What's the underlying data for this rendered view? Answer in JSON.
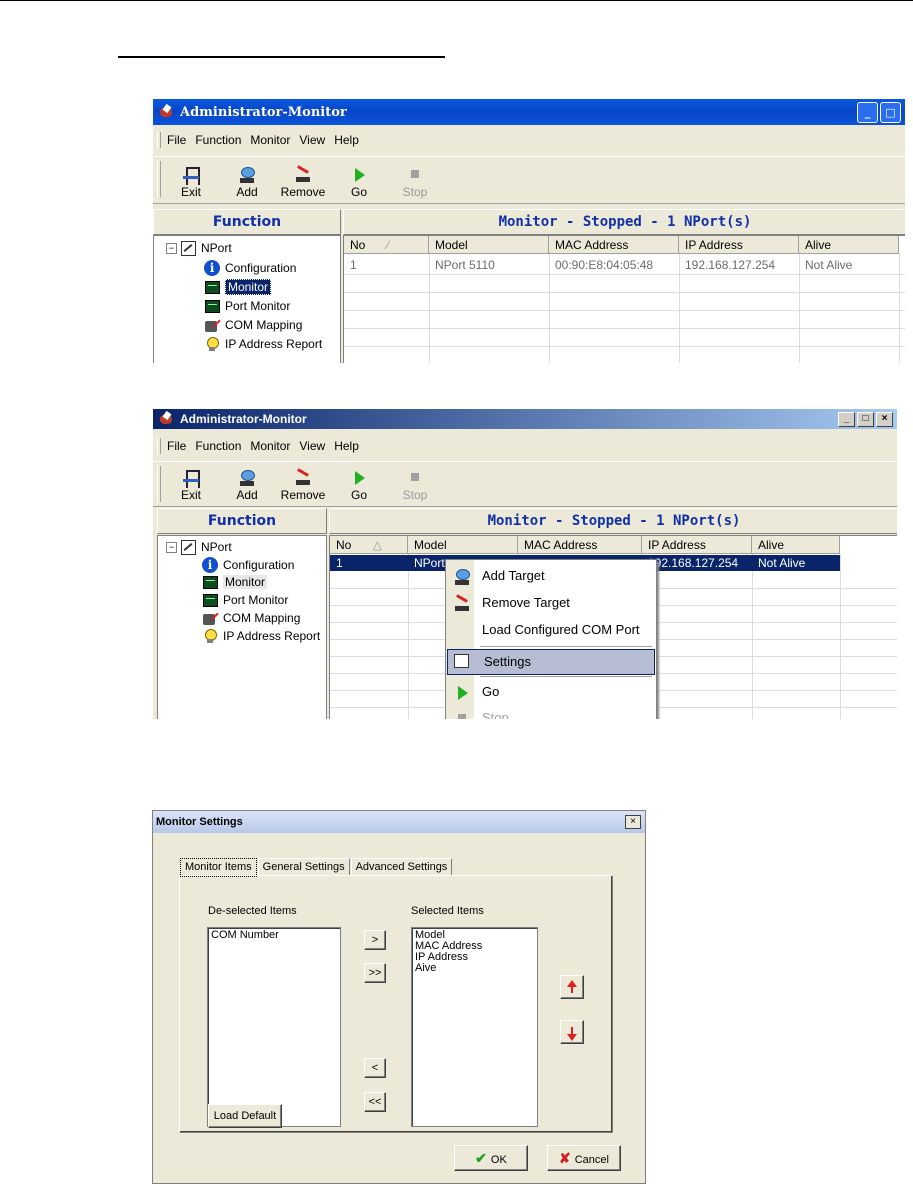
{
  "window1": {
    "title": "Administrator-Monitor",
    "menu": [
      "File",
      "Function",
      "Monitor",
      "View",
      "Help"
    ],
    "toolbar": [
      {
        "label": "Exit",
        "icon": "exit-icon",
        "enabled": true
      },
      {
        "label": "Add",
        "icon": "add-icon",
        "enabled": true
      },
      {
        "label": "Remove",
        "icon": "remove-icon",
        "enabled": true
      },
      {
        "label": "Go",
        "icon": "go-icon",
        "enabled": true
      },
      {
        "label": "Stop",
        "icon": "stop-icon",
        "enabled": false
      }
    ],
    "function_header": "Function",
    "monitor_header": "Monitor - Stopped - 1 NPort(s)",
    "tree": [
      "NPort",
      "Configuration",
      "Monitor",
      "Port Monitor",
      "COM Mapping",
      "IP Address Report"
    ],
    "columns": [
      "No",
      "Model",
      "MAC Address",
      "IP Address",
      "Alive"
    ],
    "rows": [
      [
        "1",
        "NPort 5110",
        "00:90:E8:04:05:48",
        "192.168.127.254",
        "Not Alive"
      ]
    ]
  },
  "window2": {
    "title": "Administrator-Monitor",
    "menu": [
      "File",
      "Function",
      "Monitor",
      "View",
      "Help"
    ],
    "toolbar": [
      {
        "label": "Exit",
        "icon": "exit-icon",
        "enabled": true
      },
      {
        "label": "Add",
        "icon": "add-icon",
        "enabled": true
      },
      {
        "label": "Remove",
        "icon": "remove-icon",
        "enabled": true
      },
      {
        "label": "Go",
        "icon": "go-icon",
        "enabled": true
      },
      {
        "label": "Stop",
        "icon": "stop-icon",
        "enabled": false
      }
    ],
    "function_header": "Function",
    "monitor_header": "Monitor - Stopped - 1 NPort(s)",
    "tree": [
      "NPort",
      "Configuration",
      "Monitor",
      "Port Monitor",
      "COM Mapping",
      "IP Address Report"
    ],
    "columns": [
      "No",
      "Model",
      "MAC Address",
      "IP Address",
      "Alive"
    ],
    "row": {
      "no": "1",
      "model": "NPort",
      "ip": "192.168.127.254",
      "alive": "Not Alive"
    },
    "context_menu": [
      "Add Target",
      "Remove Target",
      "Load Configured COM Port",
      "Settings",
      "Go",
      "Stop"
    ]
  },
  "dialog": {
    "title": "Monitor Settings",
    "tabs": [
      "Monitor Items",
      "General Settings",
      "Advanced Settings"
    ],
    "deselected_label": "De-selected Items",
    "selected_label": "Selected Items",
    "deselected_items": [
      "COM Number"
    ],
    "selected_items": [
      "Model",
      "MAC Address",
      "IP Address",
      "Aive"
    ],
    "move_buttons": [
      ">",
      ">>",
      "<",
      "<<"
    ],
    "load_default": "Load Default",
    "ok": "OK",
    "cancel": "Cancel"
  }
}
